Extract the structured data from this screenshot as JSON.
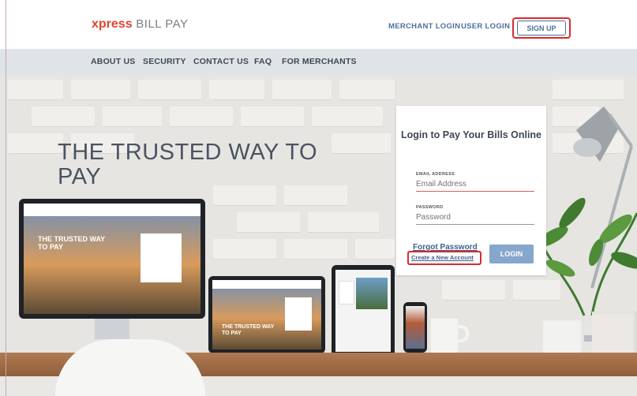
{
  "header": {
    "logo_brand": "xpress",
    "logo_rest": "BILL PAY",
    "merchant_login": "MERCHANT LOGIN",
    "user_login": "USER LOGIN",
    "sign_up": "SIGN UP"
  },
  "nav": {
    "items": [
      "ABOUT US",
      "SECURITY",
      "CONTACT US",
      "FAQ",
      "FOR MERCHANTS"
    ]
  },
  "hero": {
    "title": "THE TRUSTED WAY TO PAY",
    "monitor_text": "THE TRUSTED WAY TO PAY",
    "laptop_text": "THE TRUSTED WAY TO PAY"
  },
  "login": {
    "title": "Login to Pay Your Bills Online",
    "email_label": "EMAIL ADDRESS",
    "email_placeholder": "Email Address",
    "password_label": "PASSWORD",
    "password_placeholder": "Password",
    "forgot": "Forgot Password",
    "create": "Create a New Account",
    "login_button": "LOGIN"
  },
  "colors": {
    "brand": "#e0442f",
    "link": "#4d6f9e",
    "button": "#85a7cc",
    "highlight": "#d62c2c"
  }
}
